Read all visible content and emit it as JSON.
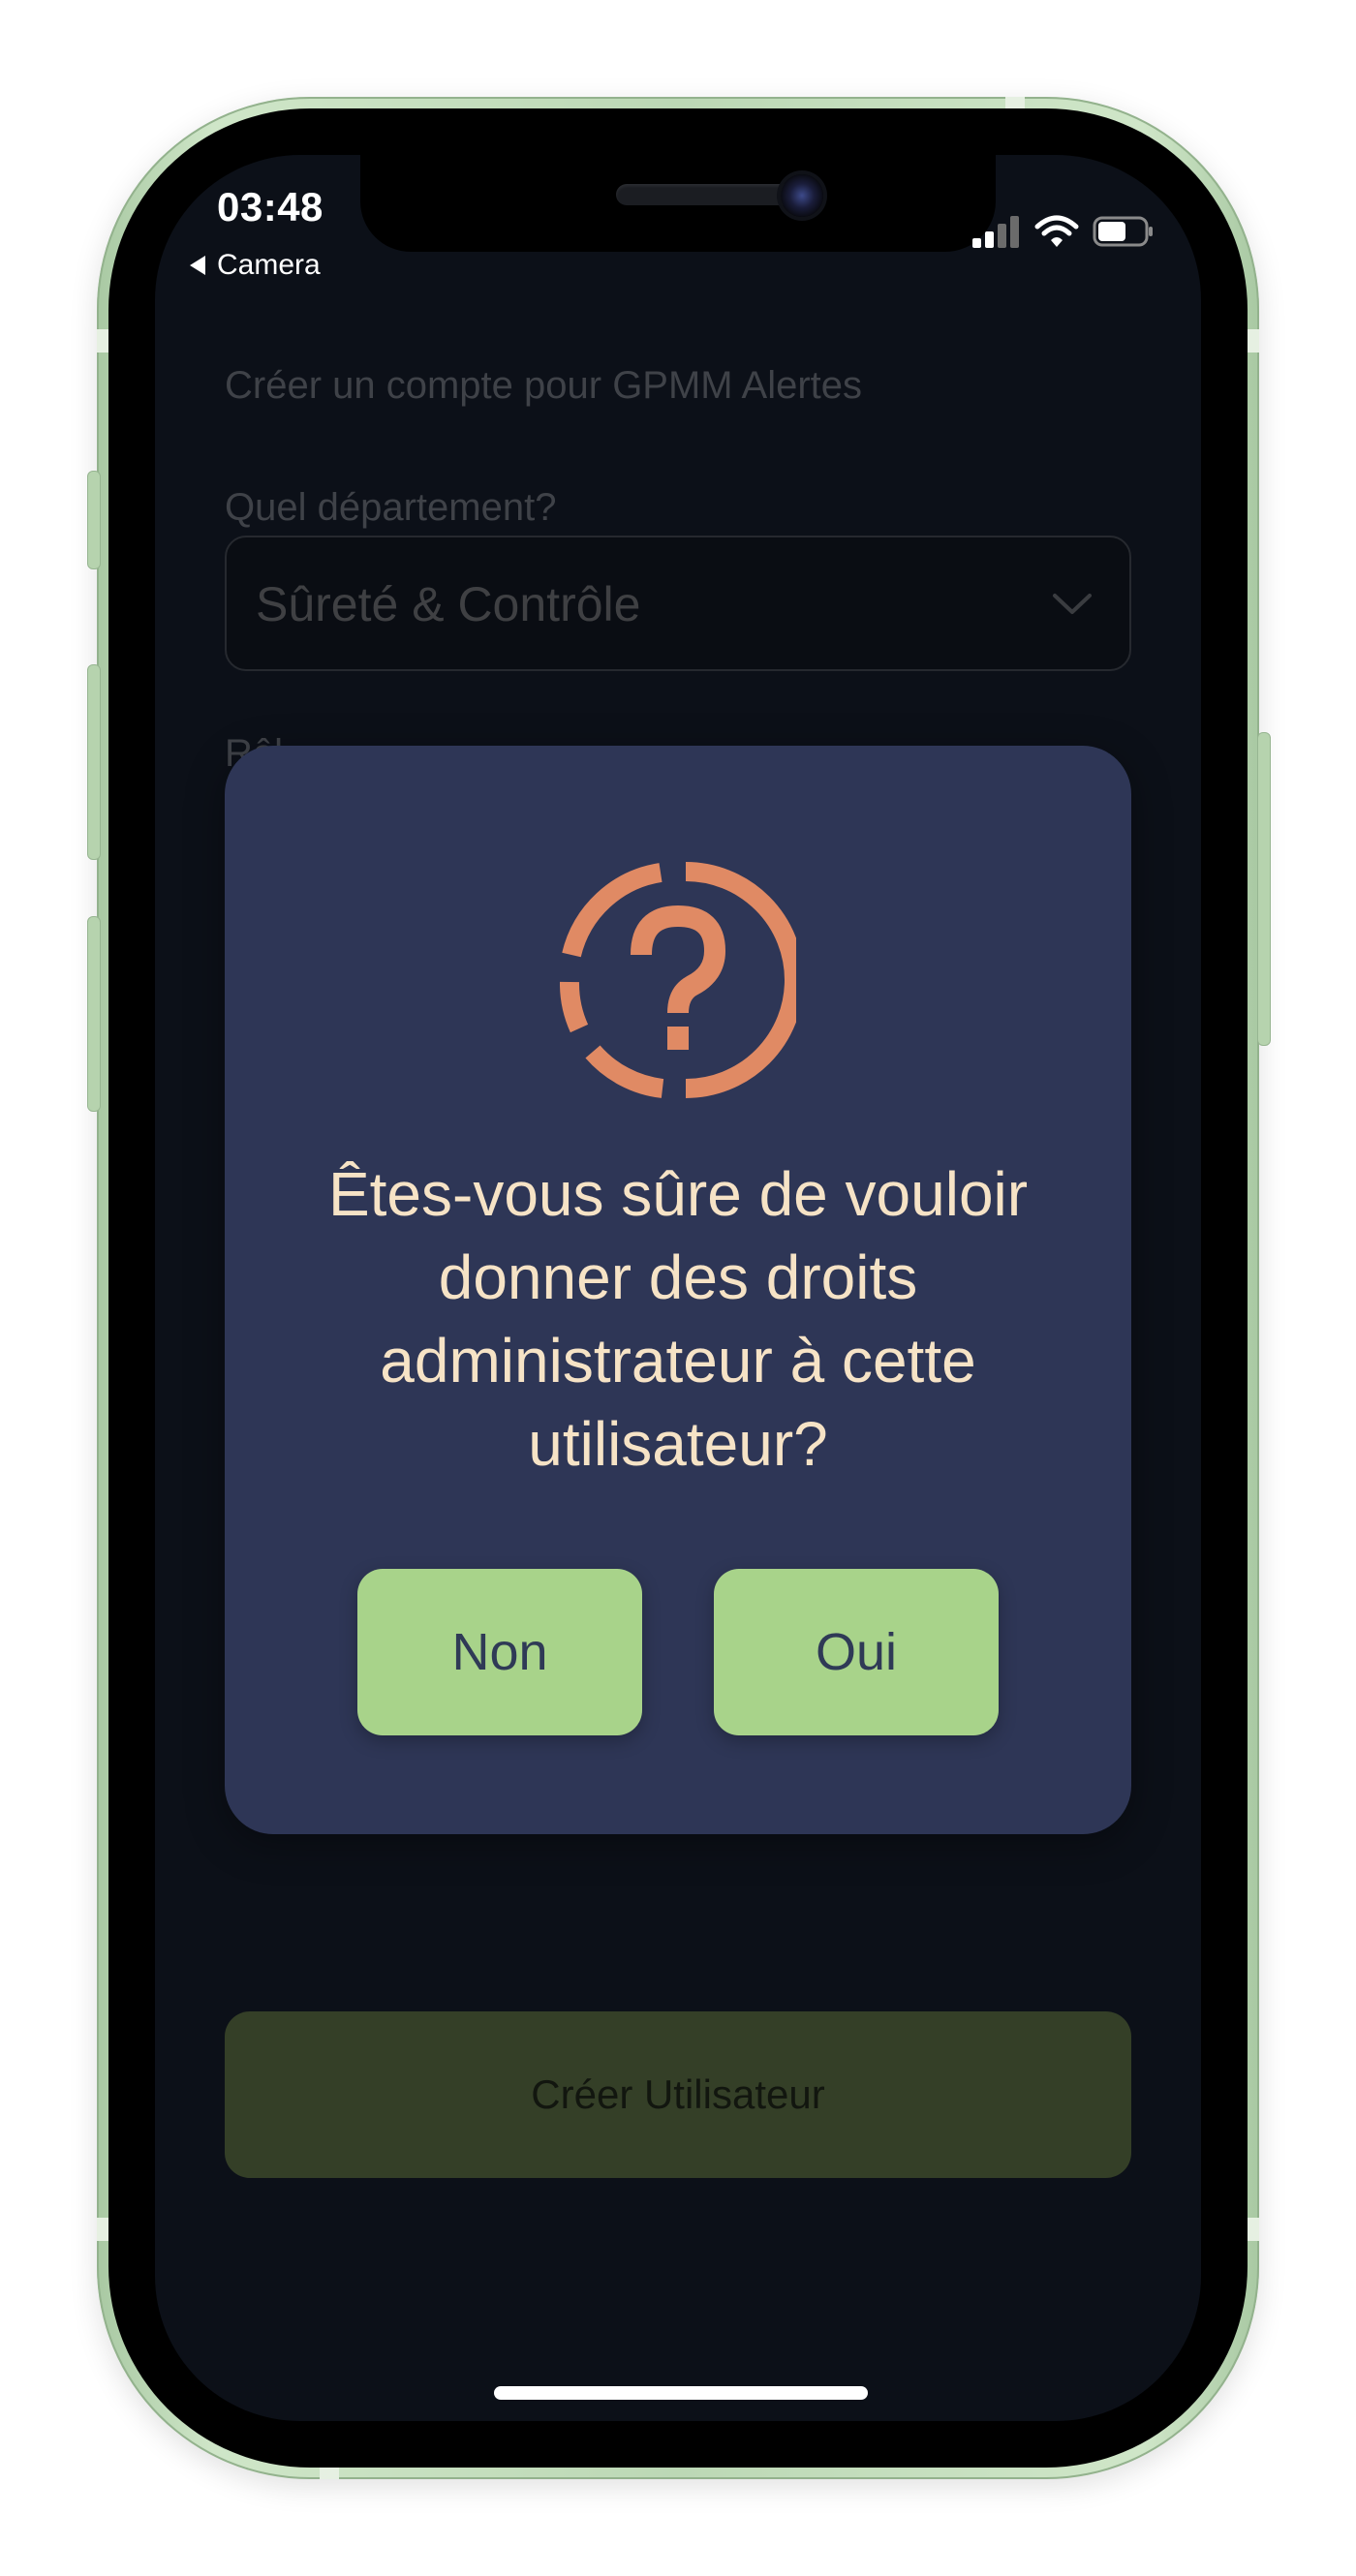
{
  "status_bar": {
    "time": "03:48",
    "back_label": "Camera"
  },
  "form": {
    "title": "Créer un compte pour GPMM Alertes",
    "department_label": "Quel département?",
    "department_value": "Sûreté & Contrôle",
    "role_label_partial": "Rôl",
    "submit_label": "Créer Utilisateur"
  },
  "dialog": {
    "icon": "question-circle-icon",
    "message": "Êtes-vous sûre de vouloir donner des droits administrateur à cette utilisateur?",
    "no_label": "Non",
    "yes_label": "Oui"
  },
  "colors": {
    "screen_bg": "#0c1018",
    "dialog_bg": "#2e3656",
    "dialog_text": "#f6e3c6",
    "icon_accent": "#e08a64",
    "button_bg": "#a8d38a",
    "button_text": "#2f3a56",
    "submit_bg_dimmed": "#343f27",
    "phone_frame": "#bcd8b5"
  }
}
